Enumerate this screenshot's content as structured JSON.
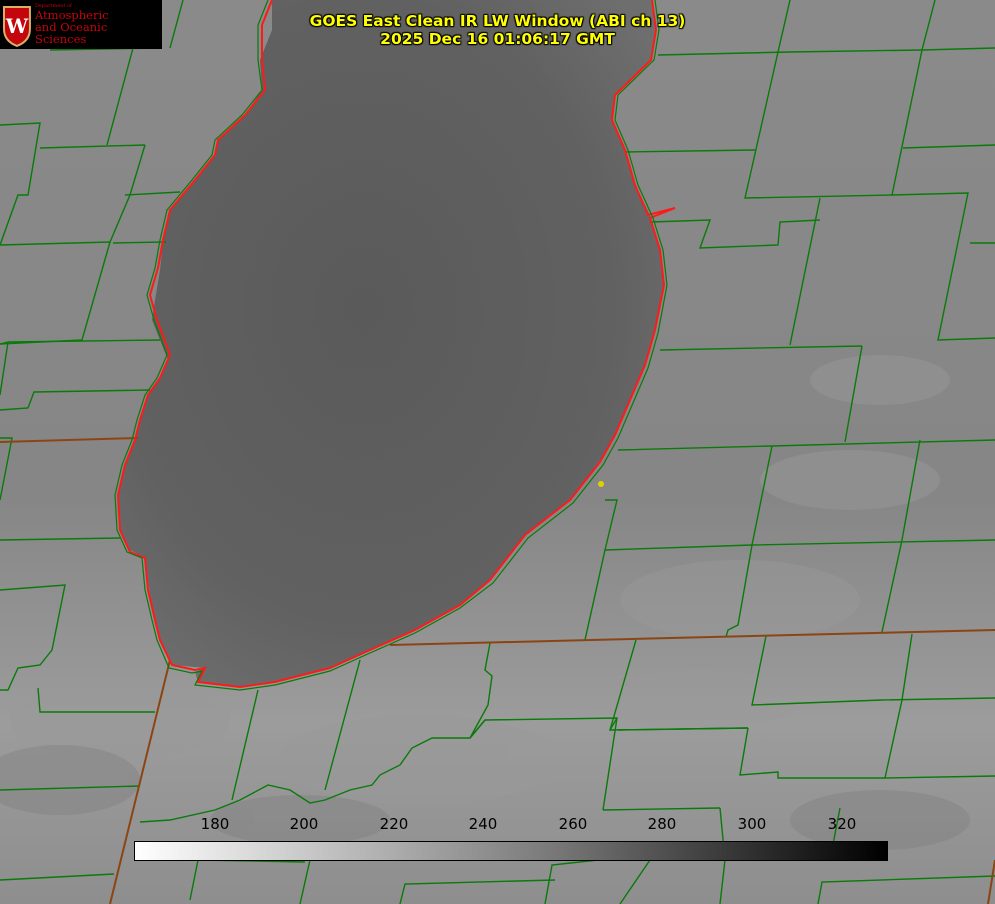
{
  "header": {
    "title_line1": "GOES East Clean IR LW Window (ABI ch 13)",
    "title_line2": "2025 Dec 16 01:06:17 GMT"
  },
  "logo": {
    "department": "Department of",
    "line1": "Atmospheric",
    "line2": "and Oceanic Sciences",
    "seal_letter": "W",
    "brand_color": "#c5050c"
  },
  "colorbar": {
    "ticks": [
      "180",
      "200",
      "220",
      "240",
      "260",
      "280",
      "300",
      "320"
    ],
    "min_color": "#ffffff",
    "max_color": "#000000"
  },
  "colors": {
    "land": "#8c8c8c",
    "lake": "#5f5f5f",
    "county_lines": "#0a7a0a",
    "state_lines": "#8b4513",
    "coastline": "#ff0000",
    "marker": "#e0d000",
    "title": "#ffff00"
  }
}
